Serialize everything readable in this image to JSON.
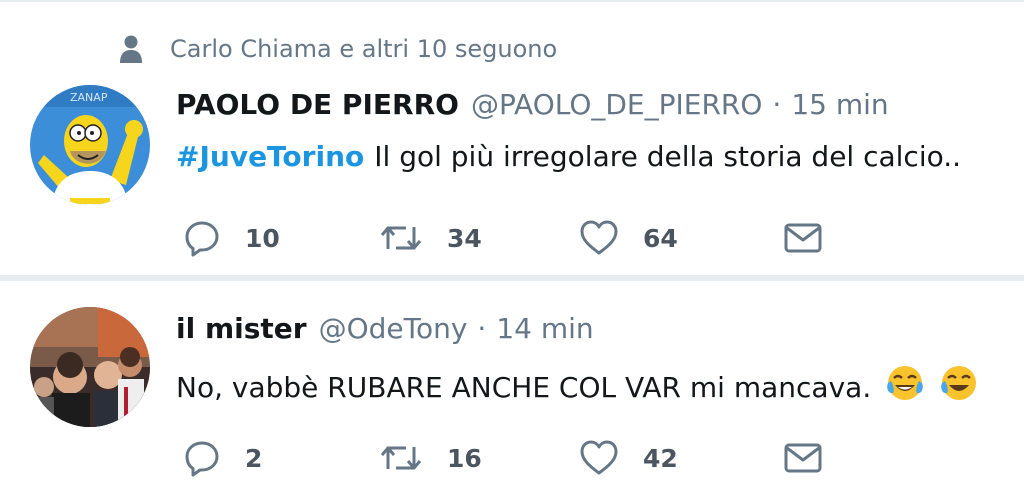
{
  "tweets": [
    {
      "social_context": "Carlo Chiama e altri 10 seguono",
      "name": "PAOLO DE PIERRO",
      "handle": "@PAOLO_DE_PIERRO",
      "separator": "·",
      "time": "15 min",
      "hashtag": "#JuveTorino",
      "text": "Il gol più irregolare della storia del calcio..",
      "replies": "10",
      "retweets": "34",
      "likes": "64"
    },
    {
      "name": "il mister",
      "handle": "@OdeTony",
      "separator": "·",
      "time": "14 min",
      "text": "No, vabbè RUBARE ANCHE COL VAR mi mancava.",
      "emoji": "face-with-tears-of-joy",
      "replies": "2",
      "retweets": "16",
      "likes": "42"
    }
  ],
  "icons": {
    "social": "person-icon",
    "reply": "reply-icon",
    "retweet": "retweet-icon",
    "like": "heart-icon",
    "dm": "envelope-icon"
  },
  "colors": {
    "link": "#1b95e0",
    "secondary": "#657786",
    "icon": "#657786",
    "separator": "#e6ecf0"
  }
}
